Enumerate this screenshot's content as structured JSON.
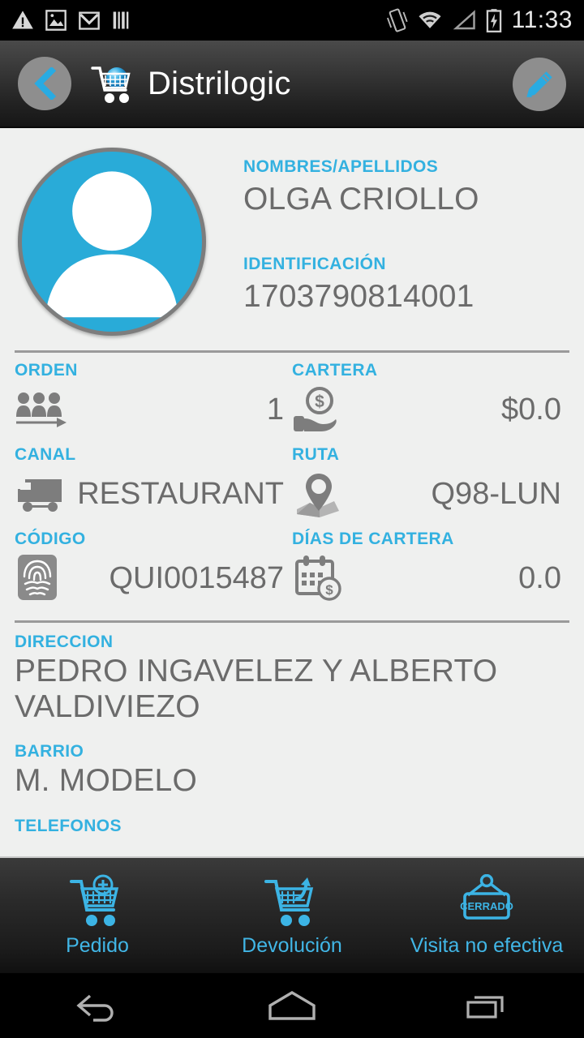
{
  "status_bar": {
    "time": "11:33",
    "left_icons": [
      "warning-icon",
      "image-icon",
      "gmail-icon",
      "barcode-icon"
    ],
    "right_icons": [
      "vibrate-icon",
      "wifi-icon",
      "signal-icon",
      "battery-charging-icon"
    ]
  },
  "app_bar": {
    "back_label": "back",
    "title": "Distrilogic",
    "logo": "shopping-cart-globe-logo",
    "edit_label": "edit"
  },
  "customer": {
    "name_label": "NOMBRES/APELLIDOS",
    "name_value": "OLGA CRIOLLO",
    "id_label": "IDENTIFICACIÓN",
    "id_value": "1703790814001",
    "avatar": "person-silhouette-avatar"
  },
  "fields": [
    {
      "label": "ORDEN",
      "value": "1",
      "icon": "people-queue-icon"
    },
    {
      "label": "CARTERA",
      "value": "$0.0",
      "icon": "hand-money-icon"
    },
    {
      "label": "CANAL",
      "value": "RESTAURANT",
      "icon": "truck-icon"
    },
    {
      "label": "RUTA",
      "value": "Q98-LUN",
      "icon": "map-pin-icon"
    },
    {
      "label": "CÓDIGO",
      "value": "QUI0015487",
      "icon": "fingerprint-icon"
    },
    {
      "label": "DÍAS DE CARTERA",
      "value": "0.0",
      "icon": "calendar-money-icon"
    }
  ],
  "address": {
    "direccion_label": "DIRECCION",
    "direccion_value": "PEDRO INGAVELEZ Y ALBERTO VALDIVIEZO",
    "barrio_label": "BARRIO",
    "barrio_value": "M. MODELO",
    "telefonos_label": "TELEFONOS"
  },
  "actions": [
    {
      "label": "Pedido",
      "icon": "cart-add-icon"
    },
    {
      "label": "Devolución",
      "icon": "cart-return-icon"
    },
    {
      "label": "Visita no efectiva",
      "icon": "cerrado-sign-icon",
      "sign_text": "CERRADO"
    }
  ],
  "nav_bar": {
    "back": "back-nav-icon",
    "home": "home-nav-icon",
    "recents": "recents-nav-icon"
  },
  "colors": {
    "accent": "#33b1e0",
    "value_text": "#6b6b6b",
    "background": "#eff0ef",
    "bar_dark": "#1b1b1b"
  }
}
